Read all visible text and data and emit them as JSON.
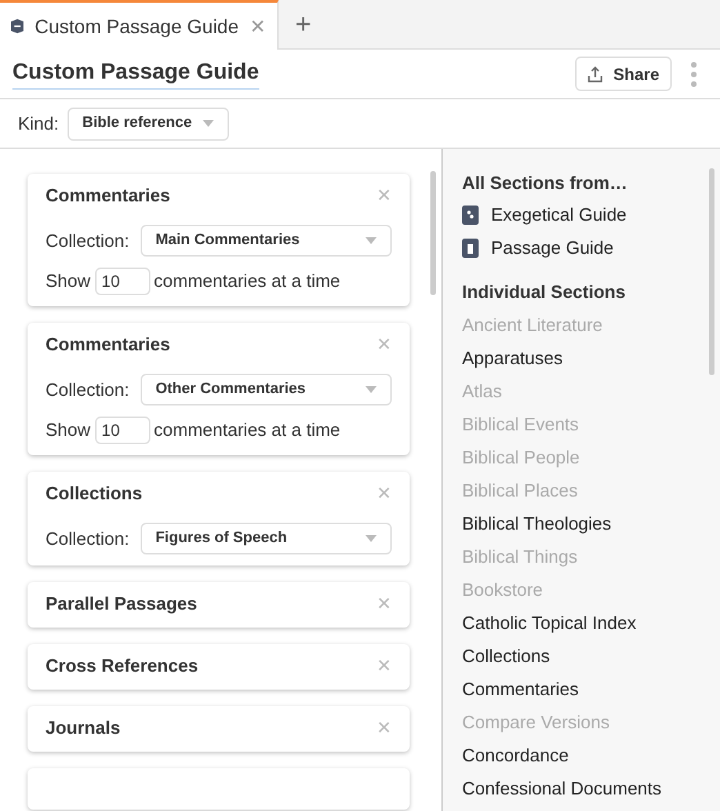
{
  "tabs": [
    {
      "label": "Custom Passage Guide",
      "selected": true,
      "close": "✕"
    }
  ],
  "new_tab": "+",
  "title": "Custom Passage Guide",
  "share_button": "Share",
  "kind": {
    "label": "Kind:",
    "value": "Bible reference"
  },
  "cards": [
    {
      "title": "Commentaries",
      "close": "✕",
      "collection_label": "Collection:",
      "collection": "Main Commentaries",
      "show_label": "Show",
      "show_value": "10",
      "show_suffix": "commentaries at a time"
    },
    {
      "title": "Commentaries",
      "close": "✕",
      "collection_label": "Collection:",
      "collection": "Other Commentaries",
      "show_label": "Show",
      "show_value": "10",
      "show_suffix": "commentaries at a time"
    },
    {
      "title": "Collections",
      "close": "✕",
      "collection_label": "Collection:",
      "collection": "Figures of Speech"
    },
    {
      "title": "Parallel Passages",
      "close": "✕"
    },
    {
      "title": "Cross References",
      "close": "✕"
    },
    {
      "title": "Journals",
      "close": "✕"
    }
  ],
  "more_cards_below": true,
  "all_sections": {
    "heading": "All Sections from…",
    "items": [
      {
        "label": "Exegetical Guide",
        "kind": "exegetical"
      },
      {
        "label": "Passage Guide",
        "kind": "passage"
      }
    ]
  },
  "individual_sections": {
    "heading": "Individual Sections",
    "items": [
      {
        "label": "Ancient Literature",
        "disabled": true
      },
      {
        "label": "Apparatuses",
        "disabled": false
      },
      {
        "label": "Atlas",
        "disabled": true
      },
      {
        "label": "Biblical Events",
        "disabled": true
      },
      {
        "label": "Biblical People",
        "disabled": true
      },
      {
        "label": "Biblical Places",
        "disabled": true
      },
      {
        "label": "Biblical Theologies",
        "disabled": false
      },
      {
        "label": "Biblical Things",
        "disabled": true
      },
      {
        "label": "Bookstore",
        "disabled": true
      },
      {
        "label": "Catholic Topical Index",
        "disabled": false
      },
      {
        "label": "Collections",
        "disabled": false
      },
      {
        "label": "Commentaries",
        "disabled": false
      },
      {
        "label": "Compare Versions",
        "disabled": true
      },
      {
        "label": "Concordance",
        "disabled": false
      },
      {
        "label": "Confessional Documents",
        "disabled": false
      }
    ]
  }
}
